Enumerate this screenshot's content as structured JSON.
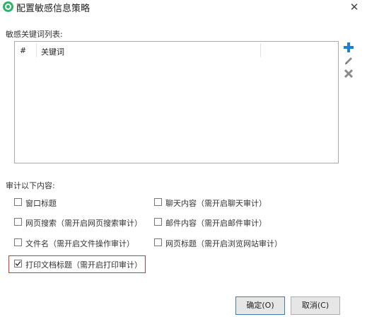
{
  "window": {
    "title": "配置敏感信息策略"
  },
  "keywords": {
    "label": "敏感关键词列表:",
    "columns": [
      "#",
      "关键词"
    ],
    "rows": []
  },
  "tools": {
    "add": "plus-icon",
    "edit": "pencil-icon",
    "delete": "x-icon"
  },
  "audit": {
    "label": "审计以下内容:",
    "options": [
      {
        "label": "窗口标题",
        "checked": false
      },
      {
        "label": "聊天内容（需开启聊天审计）",
        "checked": false
      },
      {
        "label": "网页搜索（需开启网页搜索审计）",
        "checked": false
      },
      {
        "label": "邮件内容（需开启邮件审计）",
        "checked": false
      },
      {
        "label": "文件名（需开启文件操作审计）",
        "checked": false
      },
      {
        "label": "网页标题（需开启浏览网站审计）",
        "checked": false
      },
      {
        "label": "打印文档标题（需开启打印审计）",
        "checked": true
      }
    ]
  },
  "buttons": {
    "ok": "确定(O)",
    "cancel": "取消(C)"
  },
  "colors": {
    "accent": "#1e7fd6",
    "highlight": "#dd3333",
    "app_icon": "#2fb26a"
  }
}
